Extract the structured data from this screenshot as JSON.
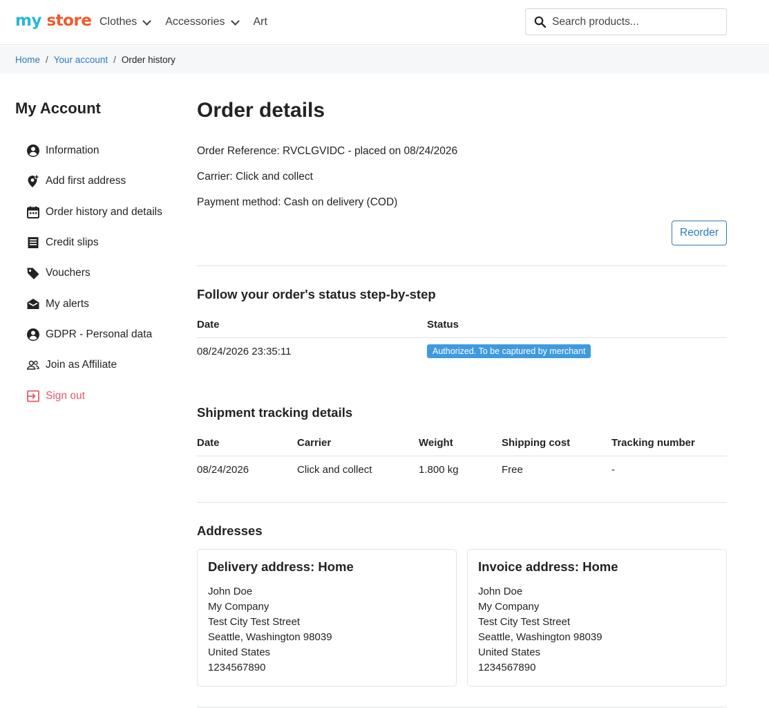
{
  "header": {
    "logo_part1": "my",
    "logo_part2": "store",
    "nav": [
      {
        "label": "Clothes",
        "has_dropdown": true
      },
      {
        "label": "Accessories",
        "has_dropdown": true
      },
      {
        "label": "Art",
        "has_dropdown": false
      }
    ],
    "search_placeholder": "Search products...",
    "brand_colors": {
      "my": "#24b9d7",
      "store": "#f05a28"
    }
  },
  "breadcrumb": {
    "items": [
      "Home",
      "Your account"
    ],
    "current": "Order history",
    "separator": "/"
  },
  "sidebar": {
    "title": "My Account",
    "items": [
      {
        "label": "Information",
        "icon": "user-circle-icon"
      },
      {
        "label": "Add first address",
        "icon": "add-location-icon"
      },
      {
        "label": "Order history and details",
        "icon": "calendar-icon"
      },
      {
        "label": "Credit slips",
        "icon": "receipt-icon"
      },
      {
        "label": "Vouchers",
        "icon": "tag-icon"
      },
      {
        "label": "My alerts",
        "icon": "envelope-open-icon"
      },
      {
        "label": "GDPR - Personal data",
        "icon": "user-circle-icon"
      },
      {
        "label": "Join as Affiliate",
        "icon": "users-icon"
      },
      {
        "label": "Sign out",
        "icon": "sign-out-icon"
      }
    ],
    "signout_color": "#e35a68"
  },
  "order": {
    "title": "Order details",
    "reference_line": "Order Reference: RVCLGVIDC - placed on 08/24/2026",
    "carrier_line": "Carrier: Click and collect",
    "payment_line": "Payment method: Cash on delivery (COD)",
    "reorder_label": "Reorder"
  },
  "status_section": {
    "title": "Follow your order's status step-by-step",
    "headers": [
      "Date",
      "Status"
    ],
    "rows": [
      {
        "date": "08/24/2026 23:35:11",
        "status": "Authorized. To be captured by merchant"
      }
    ],
    "badge_color": "#3e9ae0"
  },
  "shipment_section": {
    "title": "Shipment tracking details",
    "headers": [
      "Date",
      "Carrier",
      "Weight",
      "Shipping cost",
      "Tracking number"
    ],
    "rows": [
      [
        "08/24/2026",
        "Click and collect",
        "1.800 kg",
        "Free",
        "-"
      ]
    ]
  },
  "addresses": {
    "title": "Addresses",
    "delivery": {
      "title": "Delivery address: Home",
      "lines": [
        "John Doe",
        "My Company",
        "Test City Test Street",
        "Seattle, Washington 98039",
        "United States",
        "1234567890"
      ]
    },
    "invoice": {
      "title": "Invoice address: Home",
      "lines": [
        "John Doe",
        "My Company",
        "Test City Test Street",
        "Seattle, Washington 98039",
        "United States",
        "1234567890"
      ]
    }
  },
  "colors": {
    "link": "#2a7ac0",
    "text": "#232323"
  }
}
